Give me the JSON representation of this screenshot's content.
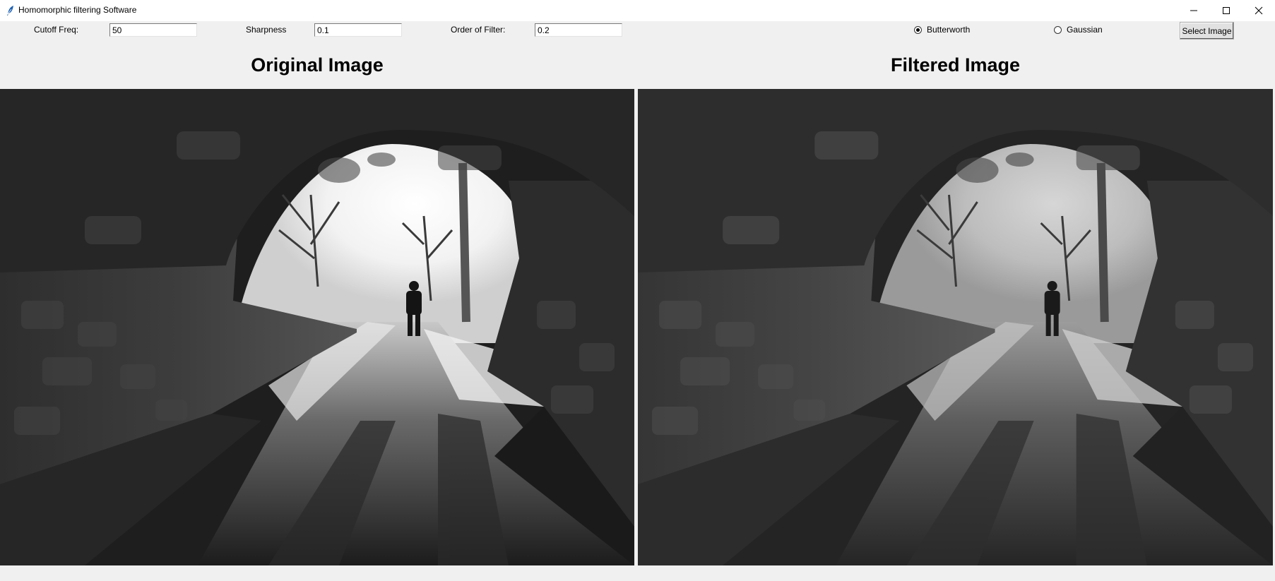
{
  "window": {
    "title": "Homomorphic filtering Software",
    "icon": "feather-icon"
  },
  "controls": {
    "cutoff_label": "Cutoff Freq:",
    "cutoff_value": "50",
    "sharpness_label": "Sharpness",
    "sharpness_value": "0.1",
    "order_label": "Order of Filter:",
    "order_value": "0.2",
    "filter_types": [
      {
        "label": "Butterworth",
        "selected": true
      },
      {
        "label": "Gaussian",
        "selected": false
      }
    ],
    "select_button": "Select Image"
  },
  "panels": {
    "original_title": "Original Image",
    "filtered_title": "Filtered Image"
  }
}
